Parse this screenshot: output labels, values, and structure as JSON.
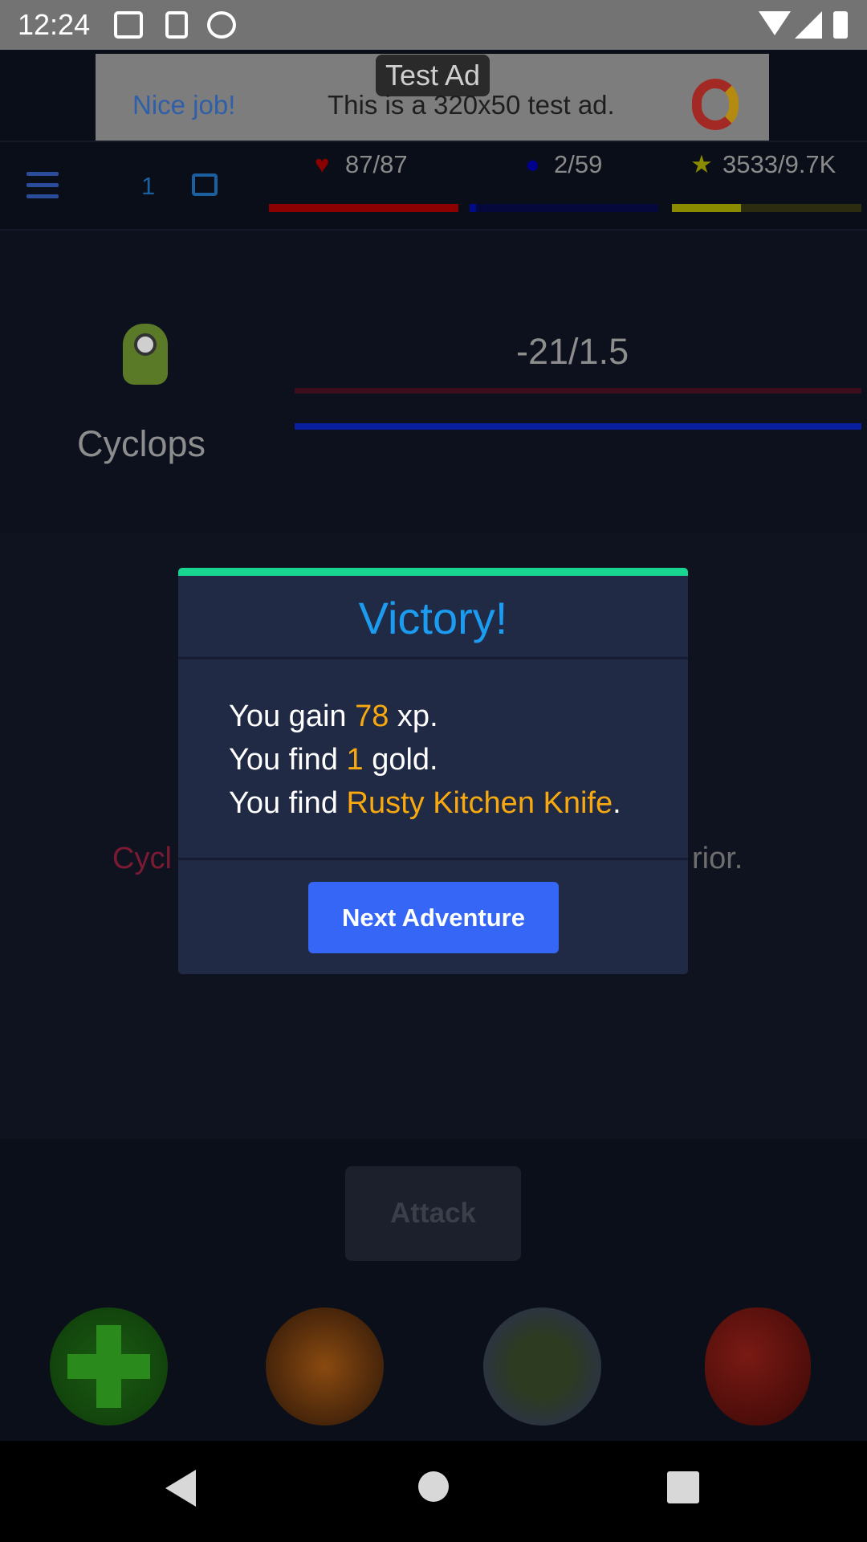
{
  "status_bar": {
    "time": "12:24"
  },
  "ad": {
    "tag": "Test Ad",
    "headline": "Nice job!",
    "text": "This is a 320x50 test ad."
  },
  "header": {
    "mail_count": "1",
    "health": "87/87",
    "mana": "2/59",
    "xp": "3533/9.7K",
    "health_fraction": 1.0,
    "mana_fraction": 0.034,
    "xp_fraction": 0.364,
    "colors": {
      "health": "#8b0000",
      "mana": "#000a8b",
      "xp": "#8b8b00"
    }
  },
  "enemy": {
    "name": "Cyclops",
    "stat": "-21/1.5",
    "health_fraction": 1.0,
    "bar2_fraction": 1.0
  },
  "log": {
    "prefix": "Cycl",
    "suffix": "rior."
  },
  "modal": {
    "title": "Victory!",
    "lines": [
      {
        "pre": "You gain ",
        "hl": "78",
        "post": " xp."
      },
      {
        "pre": "You find ",
        "hl": "1",
        "post": " gold."
      },
      {
        "pre": "You find ",
        "hl": "Rusty Kitchen Knife",
        "post": "."
      }
    ],
    "button": "Next Adventure"
  },
  "actions": {
    "attack": "Attack",
    "skills": [
      "heal-icon",
      "fire-strike-icon",
      "meditate-icon",
      "apple-icon"
    ]
  }
}
